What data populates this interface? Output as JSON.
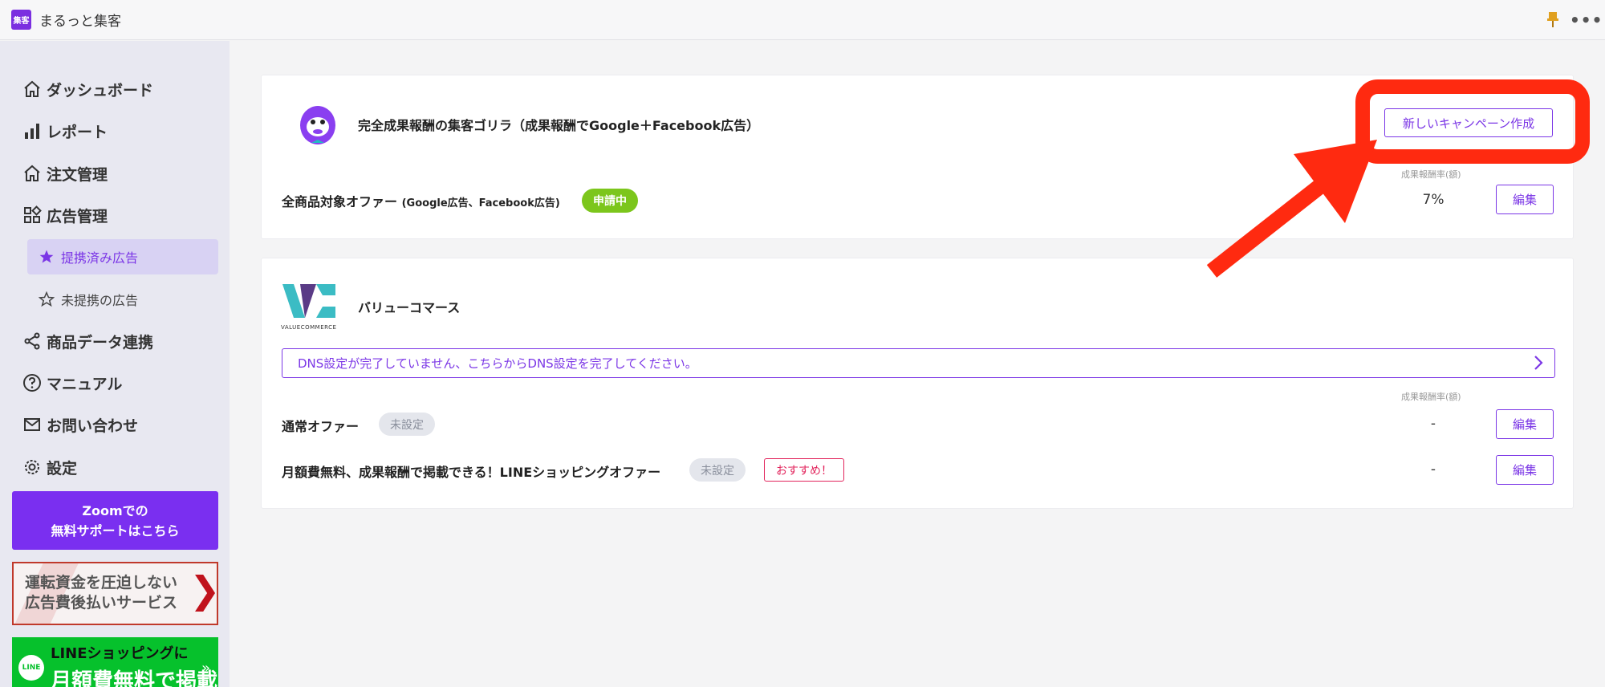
{
  "app": {
    "logo_text": "集客",
    "title": "まるっと集客"
  },
  "topbar": {
    "pin_icon": "pin-icon",
    "more_icon": "more-icon",
    "more_glyph": "•••"
  },
  "sidebar": {
    "items": [
      {
        "label": "ダッシュボード",
        "icon": "home-icon"
      },
      {
        "label": "レポート",
        "icon": "bar-chart-icon"
      },
      {
        "label": "注文管理",
        "icon": "home-icon"
      },
      {
        "label": "広告管理",
        "icon": "grid-icon"
      },
      {
        "label": "提携済み広告",
        "icon": "star-filled-icon",
        "active": true
      },
      {
        "label": "未提携の広告",
        "icon": "star-outline-icon"
      },
      {
        "label": "商品データ連携",
        "icon": "share-icon"
      },
      {
        "label": "マニュアル",
        "icon": "help-icon"
      },
      {
        "label": "お問い合わせ",
        "icon": "mail-icon"
      },
      {
        "label": "設定",
        "icon": "gear-icon"
      }
    ],
    "zoom": {
      "line1": "Zoomでの",
      "line2": "無料サポートはこちら"
    },
    "finance_banner": {
      "line1": "運転資金を圧迫しない",
      "line2": "広告費後払いサービス",
      "chevron": "❯"
    },
    "line_banner": {
      "logo": "LINE",
      "line1": "LINEショッピングに",
      "line2": "月額費無料で掲載",
      "arrow": "»"
    }
  },
  "card1": {
    "title": "完全成果報酬の集客ゴリラ（成果報酬でGoogle＋Facebook広告）",
    "new_campaign_button": "新しいキャンペーン作成",
    "offer": {
      "name": "全商品対象オファー",
      "sub": "(Google広告、Facebook広告)",
      "status": "申請中",
      "rate_label": "成果報酬率(額)",
      "rate": "7%",
      "edit_button": "編集"
    }
  },
  "card2": {
    "title": "バリューコマース",
    "logo_text": "VALUECOMMERCE",
    "dns_notice": "DNS設定が完了していません、こちらからDNS設定を完了してください。",
    "rate_label": "成果報酬率(額)",
    "offers": [
      {
        "name": "通常オファー",
        "status": "未設定",
        "rate": "-",
        "edit_button": "編集"
      },
      {
        "name": "月額費無料、成果報酬で掲載できる！LINEショッピングオファー",
        "status": "未設定",
        "recommend": "おすすめ！",
        "rate": "-",
        "edit_button": "編集"
      }
    ]
  },
  "colors": {
    "accent": "#7b36e6",
    "annotation": "#ff2a10",
    "status_green": "#7cc61c",
    "line_green": "#06c12c"
  }
}
